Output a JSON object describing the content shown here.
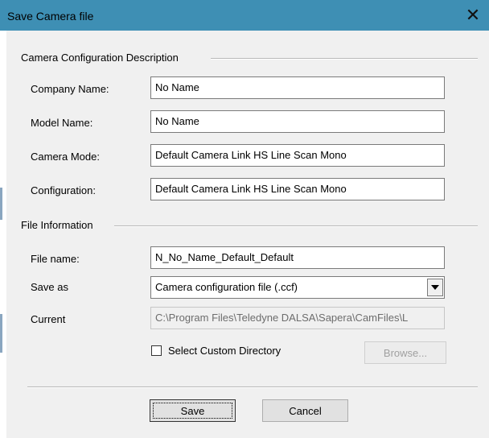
{
  "window": {
    "title": "Save Camera file",
    "close_icon": "close-icon"
  },
  "camera_section": {
    "title": "Camera Configuration Description",
    "fields": [
      {
        "label": "Company Name:",
        "value": "No Name"
      },
      {
        "label": "Model Name:",
        "value": "No Name"
      },
      {
        "label": "Camera Mode:",
        "value": "Default Camera Link HS Line Scan Mono"
      },
      {
        "label": "Configuration:",
        "value": "Default Camera Link HS Line Scan Mono"
      }
    ]
  },
  "file_section": {
    "title": "File Information",
    "file_name_label": "File name:",
    "file_name_value": "N_No_Name_Default_Default",
    "save_as_label": "Save as",
    "save_as_value": "Camera configuration file (.ccf)",
    "current_label": "Current",
    "current_value": "C:\\Program Files\\Teledyne DALSA\\Sapera\\CamFiles\\L",
    "custom_dir_label": "Select Custom Directory",
    "custom_dir_checked": false,
    "browse_label": "Browse..."
  },
  "buttons": {
    "save": "Save",
    "cancel": "Cancel"
  }
}
